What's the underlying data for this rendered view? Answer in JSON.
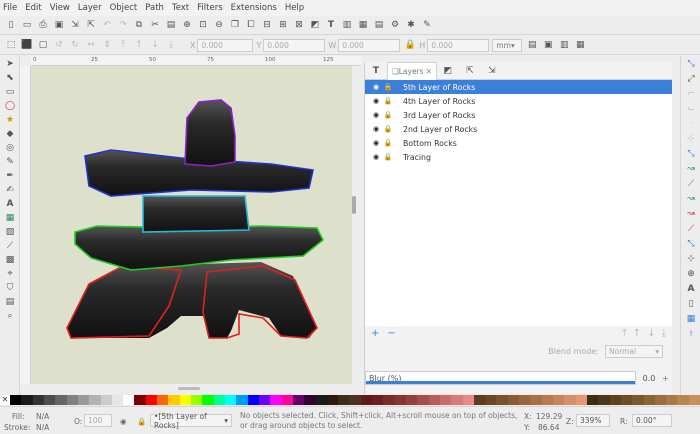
{
  "menu": [
    "File",
    "Edit",
    "View",
    "Layer",
    "Object",
    "Path",
    "Text",
    "Filters",
    "Extensions",
    "Help"
  ],
  "toolbar": {
    "x_label": "X",
    "x_value": "0.000",
    "y_label": "Y",
    "y_value": "0.000",
    "w_label": "W",
    "w_value": "0.000",
    "h_label": "H",
    "h_value": "0.000",
    "unit": "mm"
  },
  "ruler": {
    "ticks": [
      "0",
      "25",
      "50",
      "75",
      "100",
      "125"
    ]
  },
  "panel": {
    "tab_label": "Layers",
    "layers": [
      {
        "name": "5th Layer of Rocks",
        "selected": true
      },
      {
        "name": "4th Layer of Rocks",
        "selected": false
      },
      {
        "name": "3rd Layer of Rocks",
        "selected": false
      },
      {
        "name": "2nd Layer of Rocks",
        "selected": false
      },
      {
        "name": "Bottom Rocks",
        "selected": false
      },
      {
        "name": "Tracing",
        "selected": false
      }
    ],
    "blend_label": "Blend mode:",
    "blend_value": "Normal",
    "blur_label": "Blur (%)",
    "blur_value": "0.0"
  },
  "status": {
    "fill_label": "Fill:",
    "fill_value": "N/A",
    "stroke_label": "Stroke:",
    "stroke_value": "N/A",
    "opacity_label": "O:",
    "opacity_value": "100",
    "layer_value": "•[5th Layer of Rocks]",
    "message": "No objects selected. Click, Shift+click, Alt+scroll mouse on top of objects, or drag around objects to select.",
    "x_label": "X:",
    "x_value": "129.29",
    "y_label": "Y:",
    "y_value": "86.64",
    "z_label": "Z:",
    "zoom_value": "339%",
    "r_label": "R:",
    "rotate_value": "0.00°"
  },
  "palette_colors": [
    "#000000",
    "#1a1a1a",
    "#333333",
    "#4d4d4d",
    "#666666",
    "#808080",
    "#999999",
    "#b3b3b3",
    "#cccccc",
    "#e6e6e6",
    "#ffffff",
    "#800000",
    "#ff0000",
    "#ff6600",
    "#ffcc00",
    "#ffff00",
    "#99ff00",
    "#00ff00",
    "#00ff99",
    "#00ffff",
    "#0099ff",
    "#0000ff",
    "#6600ff",
    "#ff00ff",
    "#ff0099",
    "#660066",
    "#330033",
    "#1a1a1a",
    "#2b1a12",
    "#3d2b1f",
    "#4d3026",
    "#5c1a1a",
    "#6b2020",
    "#7a2b2b",
    "#8a3333",
    "#993d3d",
    "#a84d4d",
    "#b85c5c",
    "#c76b6b",
    "#d67a7a",
    "#e68a8a",
    "#5c3d1f",
    "#6b4726",
    "#7a522d",
    "#8a5c33",
    "#99663d",
    "#a87047",
    "#b87a52",
    "#c7855c",
    "#d68f66",
    "#e69970",
    "#3d2b14",
    "#4d361a",
    "#5c4220",
    "#6b4d26",
    "#7a592d",
    "#8a6433",
    "#99703d",
    "#a87a47",
    "#b88552",
    "#c78f5c"
  ]
}
